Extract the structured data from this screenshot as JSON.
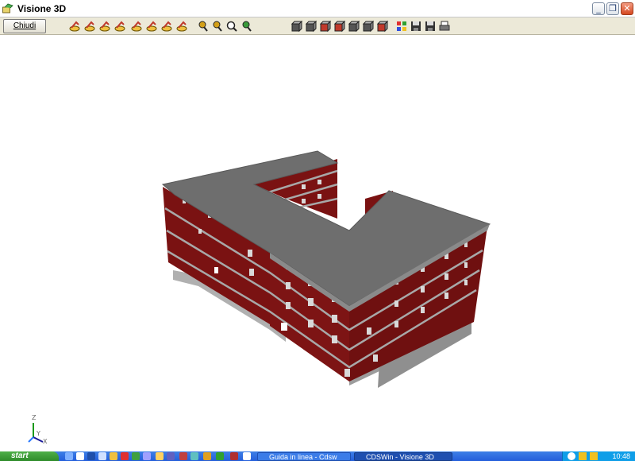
{
  "window": {
    "title": "Visione 3D"
  },
  "toolbar": {
    "close_label": "Chiudi",
    "buttons": [
      {
        "name": "rotate-left-icon",
        "color": "#c0392b"
      },
      {
        "name": "rotate-right-icon",
        "color": "#c0392b"
      },
      {
        "name": "rotate-up-icon",
        "color": "#c0392b"
      },
      {
        "name": "rotate-down-icon",
        "color": "#c0392b"
      },
      {
        "name": "pan-left-icon",
        "color": "#c0392b"
      },
      {
        "name": "pan-right-icon",
        "color": "#c0392b"
      },
      {
        "name": "pan-up-icon",
        "color": "#c0392b"
      },
      {
        "name": "pan-down-icon",
        "color": "#c0392b"
      },
      {
        "name": "zoom-in-icon",
        "color": "#d4a017"
      },
      {
        "name": "zoom-out-icon",
        "color": "#d4a017"
      },
      {
        "name": "zoom-window-icon",
        "color": "#444444"
      },
      {
        "name": "zoom-extents-icon",
        "color": "#3a9a3a"
      },
      {
        "name": "view-wireframe-icon",
        "color": "#555555"
      },
      {
        "name": "view-front-icon",
        "color": "#555555"
      },
      {
        "name": "view-side-icon",
        "color": "#c0392b"
      },
      {
        "name": "view-solid-icon",
        "color": "#c0392b"
      },
      {
        "name": "view-top-icon",
        "color": "#555555"
      },
      {
        "name": "view-iso-icon",
        "color": "#555555"
      },
      {
        "name": "view-rendered-icon",
        "color": "#c0392b"
      },
      {
        "name": "color-palette-icon",
        "color": "#1f6fd0"
      },
      {
        "name": "save-icon",
        "color": "#333333"
      },
      {
        "name": "export-image-icon",
        "color": "#333333"
      },
      {
        "name": "print-icon",
        "color": "#333333"
      }
    ]
  },
  "axes": {
    "z": "Z",
    "y": "Y",
    "x": "X"
  },
  "model": {
    "wall_color": "#7a1212",
    "slab_color": "#6e6e6e",
    "base_color": "#9a9a9a"
  },
  "taskbar": {
    "start_label": "start",
    "tasks": [
      "Guida in linea - Cdsw",
      "CDSWin - Visione 3D"
    ],
    "clock": "10:48"
  }
}
